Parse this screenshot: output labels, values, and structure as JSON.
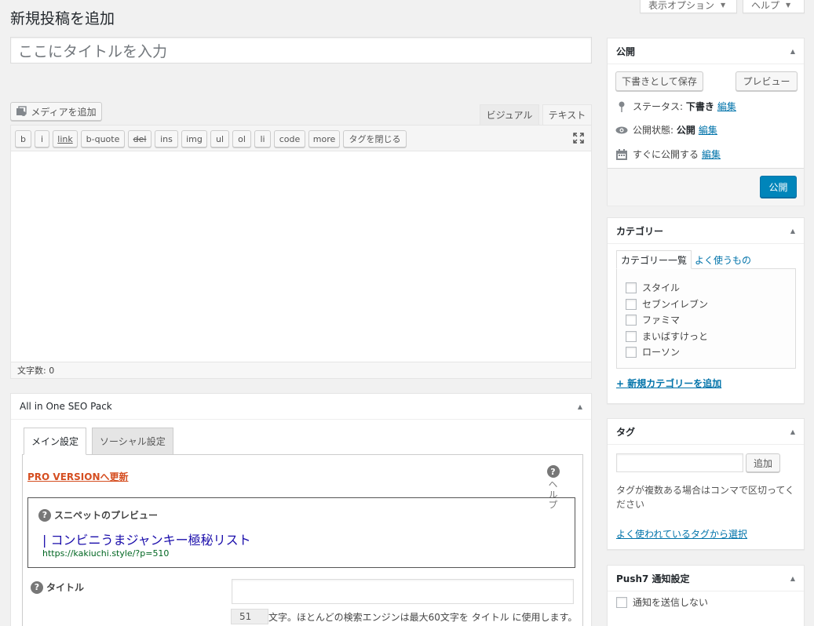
{
  "screen_meta": {
    "options_label": "表示オプション",
    "help_label": "ヘルプ"
  },
  "page_title": "新規投稿を追加",
  "title_input": {
    "placeholder": "ここにタイトルを入力"
  },
  "media_button": "メディアを追加",
  "editor_tabs": {
    "visual": "ビジュアル",
    "text": "テキスト"
  },
  "quicktags": [
    "b",
    "i",
    "link",
    "b-quote",
    "del",
    "ins",
    "img",
    "ul",
    "ol",
    "li",
    "code",
    "more",
    "タグを閉じる"
  ],
  "word_count": "文字数: 0",
  "publish": {
    "title": "公開",
    "save_draft": "下書きとして保存",
    "preview": "プレビュー",
    "status_label": "ステータス:",
    "status_value": "下書き",
    "visibility_label": "公開状態:",
    "visibility_value": "公開",
    "schedule_label": "すぐに公開する",
    "edit": "編集",
    "publish_button": "公開"
  },
  "categories": {
    "title": "カテゴリー",
    "tab_all": "カテゴリー一覧",
    "tab_popular": "よく使うもの",
    "items": [
      "スタイル",
      "セブンイレブン",
      "ファミマ",
      "まいばすけっと",
      "ローソン"
    ],
    "add_new": "+ 新規カテゴリーを追加"
  },
  "tags": {
    "title": "タグ",
    "add_button": "追加",
    "hint": "タグが複数ある場合はコンマで区切ってください",
    "choose": "よく使われているタグから選択"
  },
  "push7": {
    "title": "Push7 通知設定",
    "checkbox_label": "通知を送信しない"
  },
  "seo": {
    "title": "All in One SEO Pack",
    "tab_main": "メイン設定",
    "tab_social": "ソーシャル設定",
    "pro_link": "PRO VERSIONへ更新",
    "help": "ヘルプ",
    "snippet_label": "スニペットのプレビュー",
    "snippet_title": "| コンビニうまジャンキー極秘リスト",
    "snippet_url": "https://kakiuchi.style/?p=510",
    "title_label": "タイトル",
    "title_count": "51",
    "title_count_text": "文字。ほとんどの検索エンジンは最大60文字を タイトル に使用します。"
  }
}
